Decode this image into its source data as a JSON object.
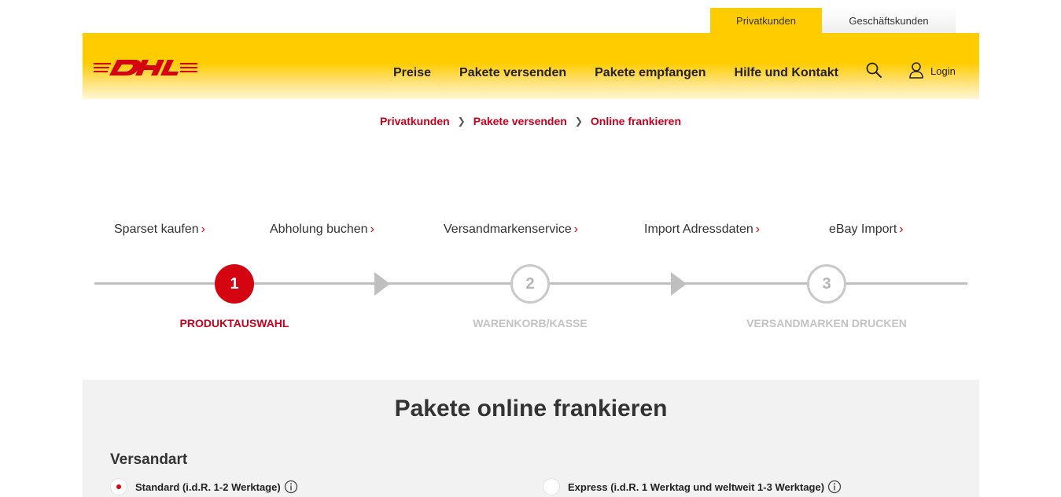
{
  "audience_tabs": [
    {
      "label": "Privatkunden",
      "active": true
    },
    {
      "label": "Geschäftskunden",
      "active": false
    }
  ],
  "brand": {
    "name": "DHL",
    "primary_color": "#ffcc00",
    "accent_color": "#d40511"
  },
  "nav": [
    {
      "label": "Preise"
    },
    {
      "label": "Pakete versenden"
    },
    {
      "label": "Pakete empfangen"
    },
    {
      "label": "Hilfe und Kontakt"
    }
  ],
  "header_actions": {
    "search_icon": "search-icon",
    "login_icon": "user-icon",
    "login_label": "Login"
  },
  "breadcrumb": [
    {
      "label": "Privatkunden"
    },
    {
      "label": "Pakete versenden"
    },
    {
      "label": "Online frankieren"
    }
  ],
  "quick_links": [
    {
      "label": "Sparset kaufen",
      "chevron": "›"
    },
    {
      "label": "Abholung buchen",
      "chevron": "›"
    },
    {
      "label": "Versandmarkenservice",
      "chevron": "›"
    },
    {
      "label": "Import Adressdaten",
      "chevron": "›"
    },
    {
      "label": "eBay Import",
      "chevron": "›"
    }
  ],
  "progress": {
    "steps": [
      {
        "number": "1",
        "label": "PRODUKTAUSWAHL",
        "state": "active"
      },
      {
        "number": "2",
        "label": "WARENKORB/KASSE",
        "state": "todo"
      },
      {
        "number": "3",
        "label": "VERSANDMARKEN DRUCKEN",
        "state": "todo"
      }
    ]
  },
  "form": {
    "title": "Pakete online frankieren",
    "section_label": "Versandart",
    "options": [
      {
        "label": "Standard (i.d.R. 1-2 Werktage)",
        "selected": true
      },
      {
        "label": "Express (i.d.R. 1 Werktag und weltweit 1-3 Werktage)",
        "selected": false
      }
    ]
  }
}
